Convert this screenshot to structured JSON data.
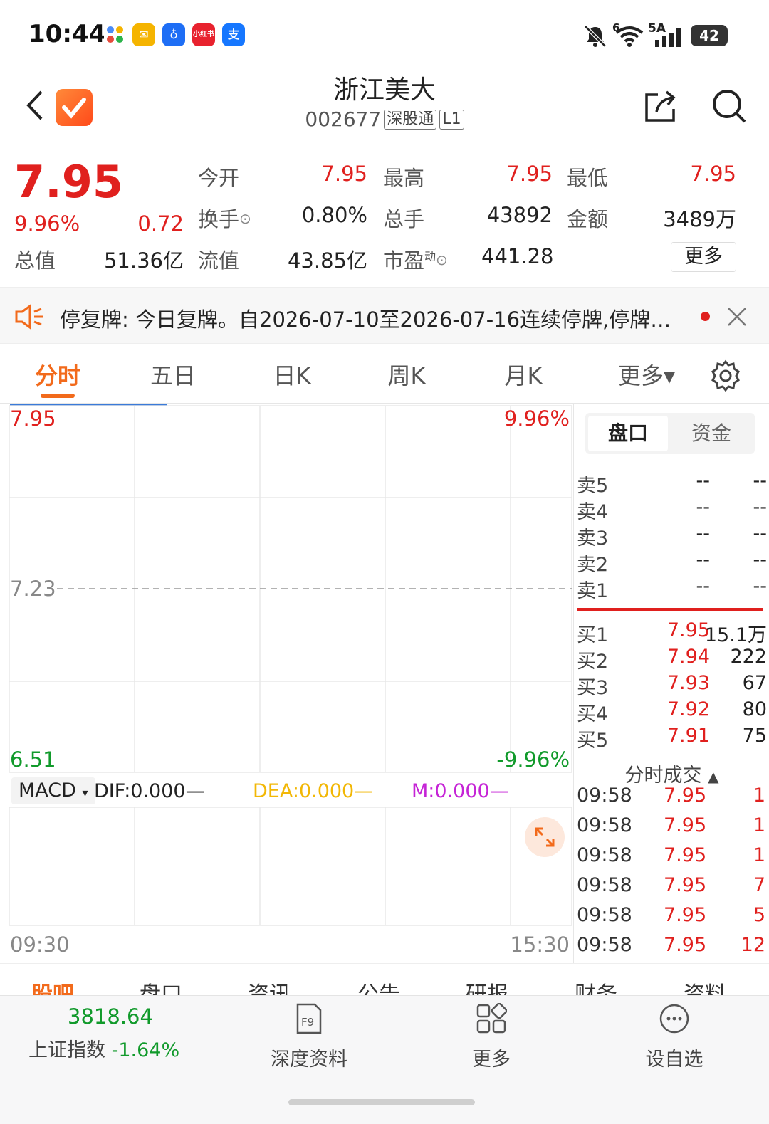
{
  "status_bar": {
    "time": "10:44",
    "battery": "42",
    "signal_label": "5A",
    "wifi_label": "6"
  },
  "status_apps": [
    "小红书"
  ],
  "header": {
    "title": "浙江美大",
    "code": "002677",
    "tags": [
      "深股通",
      "L1"
    ]
  },
  "quote": {
    "price": "7.95",
    "change_pct": "9.96%",
    "change_amt": "0.72",
    "stats": [
      {
        "label": "今开",
        "value": "7.95",
        "color": "red"
      },
      {
        "label": "最高",
        "value": "7.95",
        "color": "red"
      },
      {
        "label": "最低",
        "value": "7.95",
        "color": "red"
      },
      {
        "label": "换手",
        "value": "0.80%",
        "color": "dark"
      },
      {
        "label": "总手",
        "value": "43892",
        "color": "dark"
      },
      {
        "label": "金额",
        "value": "3489万",
        "color": "dark"
      },
      {
        "label": "总值",
        "value": "51.36亿",
        "color": "dark"
      },
      {
        "label": "流值",
        "value": "43.85亿",
        "color": "dark"
      },
      {
        "label": "市盈",
        "value": "441.28",
        "color": "dark",
        "sup": "动"
      }
    ],
    "more_label": "更多"
  },
  "notice": {
    "text": "停复牌: 今日复牌。自2026-07-10至2026-07-16连续停牌,停牌…"
  },
  "tabs": [
    "分时",
    "五日",
    "日K",
    "周K",
    "月K",
    "更多▾"
  ],
  "chart": {
    "price_high": "7.95",
    "pct_high": "9.96%",
    "price_mid": "7.23",
    "price_low": "6.51",
    "pct_low": "-9.96%",
    "time_start": "09:30",
    "time_end": "15:30",
    "macd_select": "MACD",
    "dif": "DIF:0.000—",
    "dea": "DEA:0.000—",
    "m": "M:0.000—"
  },
  "panel": {
    "seg_tabs": [
      "盘口",
      "资金"
    ],
    "sell": [
      {
        "name": "卖5",
        "price": "--",
        "vol": "--"
      },
      {
        "name": "卖4",
        "price": "--",
        "vol": "--"
      },
      {
        "name": "卖3",
        "price": "--",
        "vol": "--"
      },
      {
        "name": "卖2",
        "price": "--",
        "vol": "--"
      },
      {
        "name": "卖1",
        "price": "--",
        "vol": "--"
      }
    ],
    "buy": [
      {
        "name": "买1",
        "price": "7.95",
        "vol": "15.1万"
      },
      {
        "name": "买2",
        "price": "7.94",
        "vol": "222"
      },
      {
        "name": "买3",
        "price": "7.93",
        "vol": "67"
      },
      {
        "name": "买4",
        "price": "7.92",
        "vol": "80"
      },
      {
        "name": "买5",
        "price": "7.91",
        "vol": "75"
      }
    ],
    "trades_title": "分时成交",
    "trades": [
      {
        "time": "09:58",
        "price": "7.95",
        "vol": "1"
      },
      {
        "time": "09:58",
        "price": "7.95",
        "vol": "1"
      },
      {
        "time": "09:58",
        "price": "7.95",
        "vol": "1"
      },
      {
        "time": "09:58",
        "price": "7.95",
        "vol": "7"
      },
      {
        "time": "09:58",
        "price": "7.95",
        "vol": "5"
      },
      {
        "time": "09:58",
        "price": "7.95",
        "vol": "12"
      }
    ]
  },
  "subtabs": [
    "股吧",
    "盘口",
    "资讯",
    "公告",
    "研报",
    "财务",
    "资料"
  ],
  "bottom": {
    "index_value": "3818.64",
    "index_name": "上证指数",
    "index_change": "-1.64%",
    "items": [
      "深度资料",
      "更多",
      "设自选"
    ]
  }
}
